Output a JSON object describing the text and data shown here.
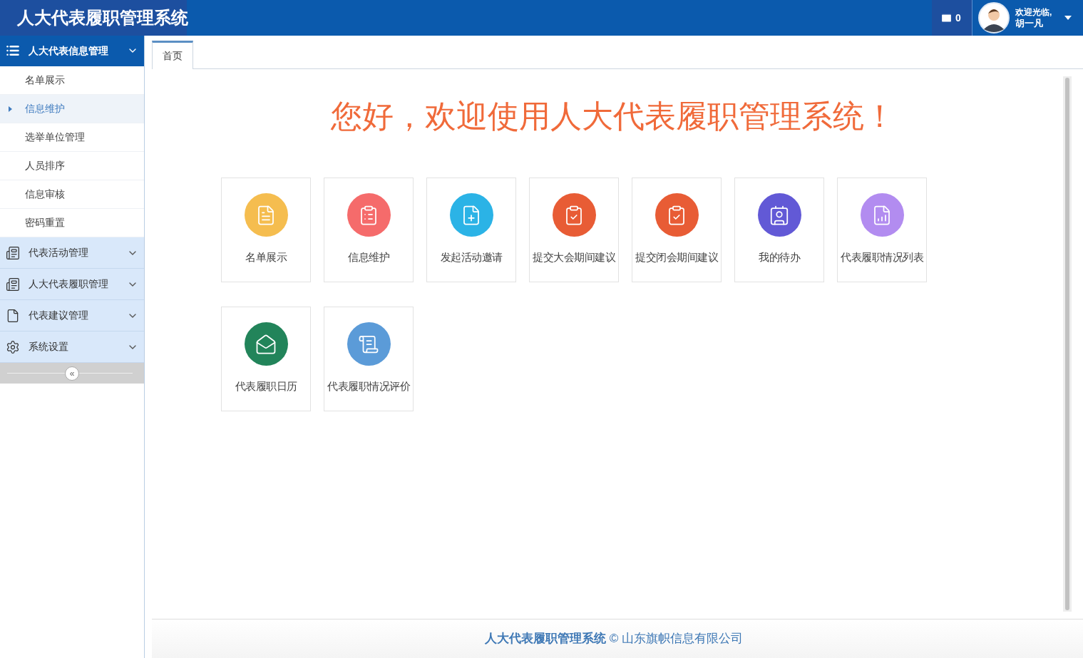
{
  "header": {
    "title": "人大代表履职管理系统",
    "messages": "0",
    "welcome": "欢迎光临,",
    "user": "胡一凡"
  },
  "sidebar": {
    "groups": [
      {
        "label": "人大代表信息管理",
        "kind": "list",
        "expanded": true,
        "children": [
          {
            "label": "名单展示",
            "selected": false
          },
          {
            "label": "信息维护",
            "selected": true
          },
          {
            "label": "选举单位管理",
            "selected": false
          },
          {
            "label": "人员排序",
            "selected": false
          },
          {
            "label": "信息审核",
            "selected": false
          },
          {
            "label": "密码重置",
            "selected": false
          }
        ]
      },
      {
        "label": "代表活动管理",
        "kind": "card",
        "expanded": false
      },
      {
        "label": "人大代表履职管理",
        "kind": "card",
        "expanded": false
      },
      {
        "label": "代表建议管理",
        "kind": "file",
        "expanded": false
      },
      {
        "label": "系统设置",
        "kind": "gear",
        "expanded": false
      }
    ],
    "collapse": "«"
  },
  "tabs": [
    {
      "label": "首页",
      "selected": true
    }
  ],
  "welcome": "您好，欢迎使用人大代表履职管理系统！",
  "tiles": [
    {
      "label": "名单展示",
      "kind": "list",
      "color": "#f5bd4f"
    },
    {
      "label": "信息维护",
      "kind": "form",
      "color": "#f56b6b"
    },
    {
      "label": "发起活动邀请",
      "kind": "add",
      "color": "#2bb3e6"
    },
    {
      "label": "提交大会期间建议",
      "kind": "submit",
      "color": "#e85c35"
    },
    {
      "label": "提交闭会期间建议",
      "kind": "submit",
      "color": "#e85c35"
    },
    {
      "label": "我的待办",
      "kind": "contact",
      "color": "#6259d6"
    },
    {
      "label": "代表履职情况列表",
      "kind": "chart",
      "color": "#b28cf0"
    },
    {
      "label": "代表履职日历",
      "kind": "mail",
      "color": "#22845a"
    },
    {
      "label": "代表履职情况评价",
      "kind": "scroll",
      "color": "#5b9bd8"
    }
  ],
  "footer": "**人大代表履职管理系统** © 山东旗帜信息有限公司"
}
